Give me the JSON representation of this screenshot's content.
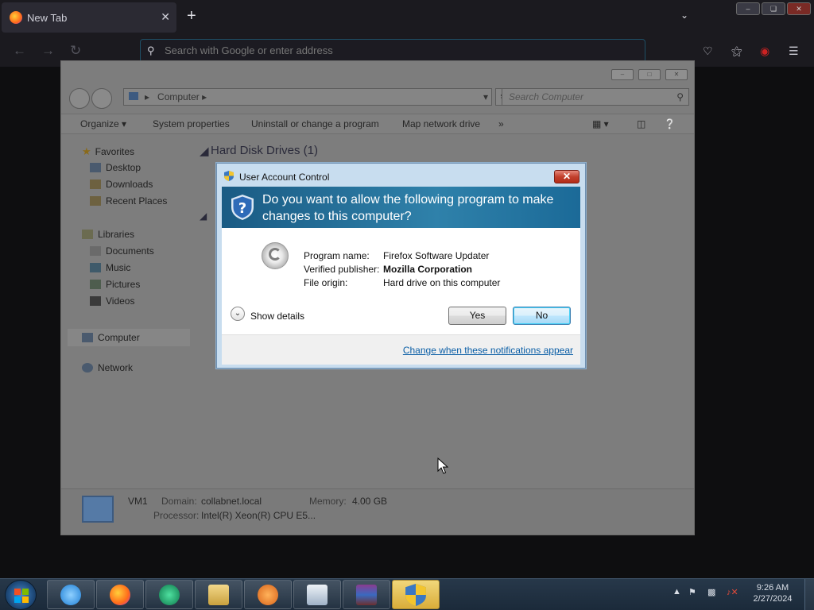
{
  "browser": {
    "tab_title": "New Tab",
    "tab_close": "✕",
    "new_tab": "+",
    "list_tabs": "⌄",
    "url_placeholder": "Search with Google or enter address",
    "colors": {
      "toolbar": "#1b1a1f",
      "tab": "#2b2a33"
    }
  },
  "explorer": {
    "address": "Computer",
    "address_chevron": "▸",
    "search_placeholder": "Search Computer",
    "toolbar": {
      "organize": "Organize ▾",
      "system_properties": "System properties",
      "uninstall": "Uninstall or change a program",
      "map_drive": "Map network drive",
      "more": "»"
    },
    "nav": {
      "favorites": "Favorites",
      "desktop": "Desktop",
      "downloads": "Downloads",
      "recent": "Recent Places",
      "libraries": "Libraries",
      "documents": "Documents",
      "music": "Music",
      "pictures": "Pictures",
      "videos": "Videos",
      "computer": "Computer",
      "network": "Network"
    },
    "group_hard_disk": "Hard Disk Drives (1)",
    "status": {
      "name": "VM1",
      "domain_label": "Domain:",
      "domain_value": "collabnet.local",
      "memory_label": "Memory:",
      "memory_value": "4.00 GB",
      "processor_label": "Processor:",
      "processor_value": "Intel(R) Xeon(R) CPU E5..."
    }
  },
  "uac": {
    "title": "User Account Control",
    "question": "Do you want to allow the following program to make changes to this computer?",
    "program_name_label": "Program name:",
    "program_name": "Firefox Software Updater",
    "publisher_label": "Verified publisher:",
    "publisher": "Mozilla Corporation",
    "origin_label": "File origin:",
    "origin": "Hard drive on this computer",
    "show_details": "Show details",
    "yes": "Yes",
    "no": "No",
    "change_link": "Change when these notifications appear",
    "colors": {
      "banner": "#2f81aa",
      "link": "#0a5ea6"
    }
  },
  "taskbar": {
    "time": "9:26 AM",
    "date": "2/27/2024"
  }
}
